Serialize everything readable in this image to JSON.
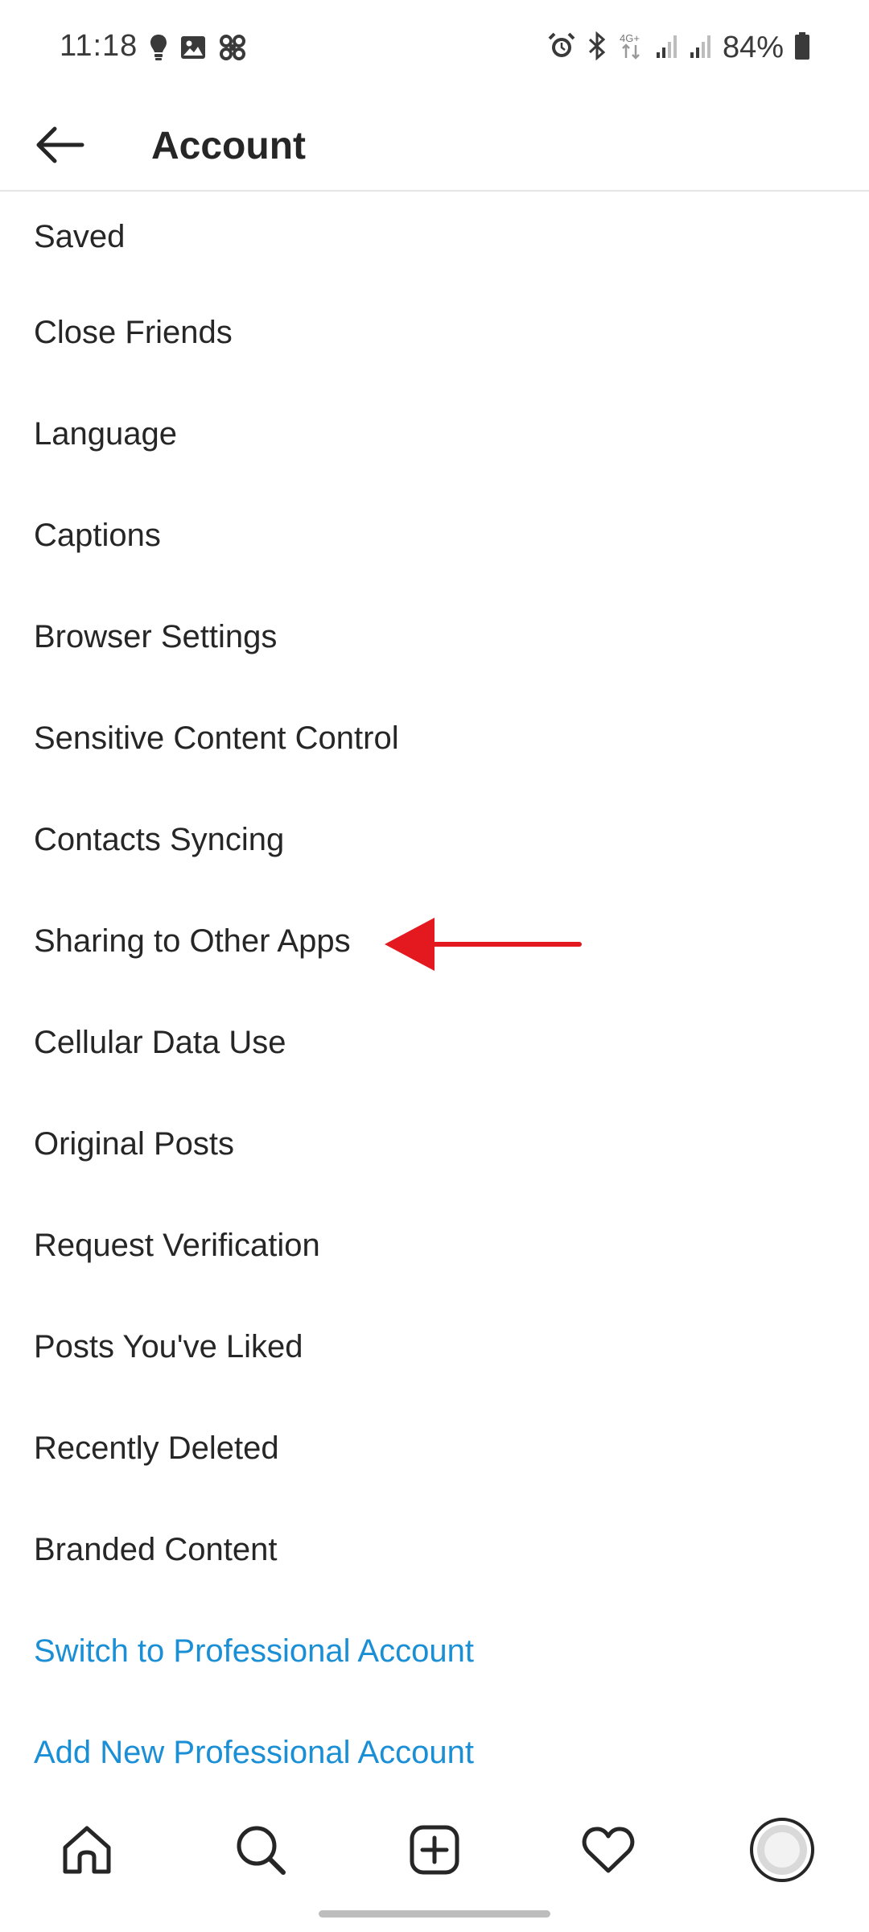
{
  "status_bar": {
    "time": "11:18",
    "battery": "84%",
    "icons_left": [
      "bulb-icon",
      "gallery-icon",
      "fan-icon"
    ],
    "icons_right": [
      "alarm-icon",
      "bluetooth-icon",
      "network-4g-icon",
      "signal-icon",
      "signal-icon",
      "battery-icon"
    ]
  },
  "header": {
    "title": "Account",
    "back_icon": "arrow-left-icon"
  },
  "menu": {
    "items": [
      {
        "label": "Saved"
      },
      {
        "label": "Close Friends"
      },
      {
        "label": "Language"
      },
      {
        "label": "Captions"
      },
      {
        "label": "Browser Settings"
      },
      {
        "label": "Sensitive Content Control"
      },
      {
        "label": "Contacts Syncing"
      },
      {
        "label": "Sharing to Other Apps"
      },
      {
        "label": "Cellular Data Use"
      },
      {
        "label": "Original Posts"
      },
      {
        "label": "Request Verification"
      },
      {
        "label": "Posts You've Liked"
      },
      {
        "label": "Recently Deleted"
      },
      {
        "label": "Branded Content"
      }
    ],
    "links": [
      {
        "label": "Switch to Professional Account"
      },
      {
        "label": "Add New Professional Account"
      }
    ]
  },
  "annotation": {
    "color": "#e3191f",
    "points_to": "Sharing to Other Apps"
  },
  "bottom_nav": {
    "items": [
      "home-icon",
      "search-icon",
      "new-post-icon",
      "activity-heart-icon",
      "profile-avatar"
    ]
  },
  "colors": {
    "text": "#262626",
    "link": "#1a8fd6",
    "divider": "#e6e6e6"
  }
}
